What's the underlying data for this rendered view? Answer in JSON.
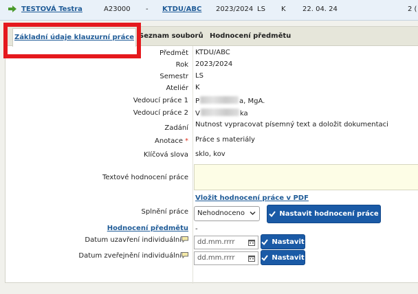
{
  "record": {
    "student": "TESTOVÁ Testra",
    "code": "A23000",
    "dash": "-",
    "subject": "KTDU/ABC",
    "year": "2023/2024",
    "semester": "LS",
    "type": "K",
    "date": "22. 04. 24",
    "truncated": "2 ("
  },
  "tabs": {
    "basic": "Základní údaje klauzurní práce",
    "files": "Seznam souborů",
    "eval": "Hodnocení předmětu"
  },
  "fields": {
    "subject_label": "Předmět",
    "subject_value": "KTDU/ABC",
    "year_label": "Rok",
    "year_value": "2023/2024",
    "semester_label": "Semestr",
    "semester_value": "LS",
    "studio_label": "Ateliér",
    "studio_value": "K",
    "supervisor1_label": "Vedoucí práce 1",
    "supervisor1_prefix": "P",
    "supervisor1_suffix": "a, MgA.",
    "supervisor2_label": "Vedoucí práce 2",
    "supervisor2_prefix": "V",
    "supervisor2_suffix": "ka",
    "assignment_label": "Zadání",
    "assignment_value": "Nutnost vypracovat písemný text a doložit dokumentaci",
    "annotation_label": "Anotace",
    "annotation_required": "*",
    "annotation_value": "Práce s materiály",
    "keywords_label": "Klíčová slova",
    "keywords_value": "sklo, kov",
    "text_eval_label": "Textové hodnocení práce",
    "insert_pdf_link": "Vložit hodnocení práce v PDF",
    "completion_label": "Splnění práce",
    "completion_selected": "Nehodnoceno",
    "set_eval_button": "Nastavit hodnocení práce",
    "course_eval_link": "Hodnocení předmětu",
    "course_eval_value": "-",
    "close_date_label": "Datum uzavření individuální",
    "publish_date_label": "Datum zveřejnění individuální",
    "date_placeholder": "dd.mm.rrrr",
    "set_button": "Nastavit"
  },
  "colors": {
    "accent": "#1a5aa6",
    "link": "#1f5b97",
    "highlight": "#e5191d",
    "required": "#e0321e"
  }
}
